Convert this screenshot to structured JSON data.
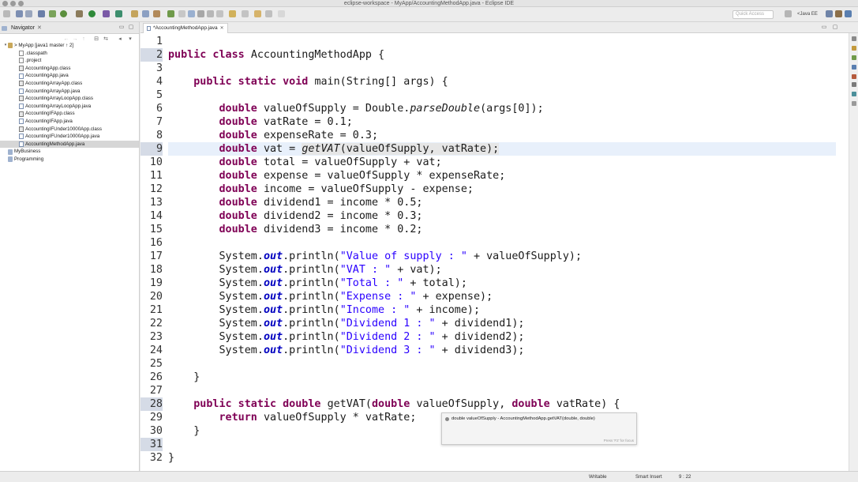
{
  "window": {
    "title": "eclipse-workspace - MyApp/AccountingMethodApp.java - Eclipse IDE"
  },
  "toolbar": {
    "quick_access_placeholder": "Quick Access",
    "perspective": "Java EE"
  },
  "navigator": {
    "tab_label": "Navigator",
    "items": [
      {
        "label": "> MyApp [java1 master ↑ 2]",
        "type": "project",
        "depth": 0,
        "expanded": true
      },
      {
        "label": ".classpath",
        "type": "file",
        "depth": 1
      },
      {
        "label": ".project",
        "type": "file",
        "depth": 1
      },
      {
        "label": "AccountingApp.class",
        "type": "classfile",
        "depth": 1
      },
      {
        "label": "AccountingApp.java",
        "type": "javafile",
        "depth": 1
      },
      {
        "label": "AccountingArrayApp.class",
        "type": "classfile",
        "depth": 1
      },
      {
        "label": "AccountingArrayApp.java",
        "type": "javafile",
        "depth": 1
      },
      {
        "label": "AccountingArrayLoopApp.class",
        "type": "classfile",
        "depth": 1
      },
      {
        "label": "AccountingArrayLoopApp.java",
        "type": "javafile",
        "depth": 1
      },
      {
        "label": "AccountingIFApp.class",
        "type": "classfile",
        "depth": 1
      },
      {
        "label": "AccountingIFApp.java",
        "type": "javafile",
        "depth": 1
      },
      {
        "label": "AccountingIFUnder10000App.class",
        "type": "classfile",
        "depth": 1
      },
      {
        "label": "AccountingIFUnder10000App.java",
        "type": "javafile",
        "depth": 1
      },
      {
        "label": "AccountingMethodApp.java",
        "type": "javafile",
        "depth": 1,
        "selected": true
      },
      {
        "label": "MyBusiness",
        "type": "folder",
        "depth": 0
      },
      {
        "label": "Programming",
        "type": "folder",
        "depth": 0
      }
    ]
  },
  "editor": {
    "tab_label": "*AccountingMethodApp.java",
    "current_line": 9,
    "marked_lines": [
      2,
      9,
      28,
      31
    ],
    "lines": [
      [],
      [
        [
          "k",
          "public class "
        ],
        [
          "",
          "AccountingMethodApp {"
        ]
      ],
      [],
      [
        [
          "",
          "    "
        ],
        [
          "k",
          "public static void "
        ],
        [
          "",
          "main(String[] args) {"
        ]
      ],
      [],
      [
        [
          "",
          "        "
        ],
        [
          "k",
          "double "
        ],
        [
          "",
          "valueOfSupply = Double."
        ],
        [
          "i",
          "parseDouble"
        ],
        [
          "",
          "(args[0]);"
        ]
      ],
      [
        [
          "",
          "        "
        ],
        [
          "k",
          "double "
        ],
        [
          "",
          "vatRate = 0.1;"
        ]
      ],
      [
        [
          "",
          "        "
        ],
        [
          "k",
          "double "
        ],
        [
          "",
          "expenseRate = 0.3;"
        ]
      ],
      [
        [
          "",
          "        "
        ],
        [
          "k",
          "double "
        ],
        [
          "",
          "vat = "
        ],
        [
          "hli",
          "getVAT"
        ],
        [
          "hl",
          "(valueOfSupply, vatRate);"
        ]
      ],
      [
        [
          "",
          "        "
        ],
        [
          "k",
          "double "
        ],
        [
          "",
          "total = valueOfSupply + vat;"
        ]
      ],
      [
        [
          "",
          "        "
        ],
        [
          "k",
          "double "
        ],
        [
          "",
          "expense = valueOfSupply * expenseRate;"
        ]
      ],
      [
        [
          "",
          "        "
        ],
        [
          "k",
          "double "
        ],
        [
          "",
          "income = valueOfSupply - expense;"
        ]
      ],
      [
        [
          "",
          "        "
        ],
        [
          "k",
          "double "
        ],
        [
          "",
          "dividend1 = income * 0.5;"
        ]
      ],
      [
        [
          "",
          "        "
        ],
        [
          "k",
          "double "
        ],
        [
          "",
          "dividend2 = income * 0.3;"
        ]
      ],
      [
        [
          "",
          "        "
        ],
        [
          "k",
          "double "
        ],
        [
          "",
          "dividend3 = income * 0.2;"
        ]
      ],
      [],
      [
        [
          "",
          "        System."
        ],
        [
          "f",
          "out"
        ],
        [
          "",
          ".println("
        ],
        [
          "s",
          "\"Value of supply : \""
        ],
        [
          "",
          " + valueOfSupply);"
        ]
      ],
      [
        [
          "",
          "        System."
        ],
        [
          "f",
          "out"
        ],
        [
          "",
          ".println("
        ],
        [
          "s",
          "\"VAT : \""
        ],
        [
          "",
          " + vat);"
        ]
      ],
      [
        [
          "",
          "        System."
        ],
        [
          "f",
          "out"
        ],
        [
          "",
          ".println("
        ],
        [
          "s",
          "\"Total : \""
        ],
        [
          "",
          " + total);"
        ]
      ],
      [
        [
          "",
          "        System."
        ],
        [
          "f",
          "out"
        ],
        [
          "",
          ".println("
        ],
        [
          "s",
          "\"Expense : \""
        ],
        [
          "",
          " + expense);"
        ]
      ],
      [
        [
          "",
          "        System."
        ],
        [
          "f",
          "out"
        ],
        [
          "",
          ".println("
        ],
        [
          "s",
          "\"Income : \""
        ],
        [
          "",
          " + income);"
        ]
      ],
      [
        [
          "",
          "        System."
        ],
        [
          "f",
          "out"
        ],
        [
          "",
          ".println("
        ],
        [
          "s",
          "\"Dividend 1 : \""
        ],
        [
          "",
          " + dividend1);"
        ]
      ],
      [
        [
          "",
          "        System."
        ],
        [
          "f",
          "out"
        ],
        [
          "",
          ".println("
        ],
        [
          "s",
          "\"Dividend 2 : \""
        ],
        [
          "",
          " + dividend2);"
        ]
      ],
      [
        [
          "",
          "        System."
        ],
        [
          "f",
          "out"
        ],
        [
          "",
          ".println("
        ],
        [
          "s",
          "\"Dividend 3 : \""
        ],
        [
          "",
          " + dividend3);"
        ]
      ],
      [],
      [
        [
          "",
          "    }"
        ]
      ],
      [],
      [
        [
          "",
          "    "
        ],
        [
          "k",
          "public static double "
        ],
        [
          "",
          "getVAT("
        ],
        [
          "k",
          "double "
        ],
        [
          "",
          "valueOfSupply, "
        ],
        [
          "k",
          "double "
        ],
        [
          "",
          "vatRate) {"
        ]
      ],
      [
        [
          "",
          "        "
        ],
        [
          "k",
          "return "
        ],
        [
          "",
          "valueOfSupply * vatRate;"
        ]
      ],
      [
        [
          "",
          "    }"
        ]
      ],
      [],
      [
        [
          "",
          "}"
        ]
      ]
    ]
  },
  "hover": {
    "text": "double valueOfSupply - AccountingMethodApp.getVAT(double, double)",
    "footer": "Press 'F2' for focus"
  },
  "status": {
    "writable": "Writable",
    "insert_mode": "Smart Insert",
    "position": "9 : 22"
  }
}
